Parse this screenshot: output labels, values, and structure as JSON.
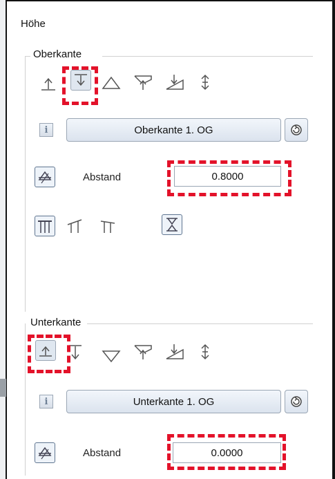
{
  "panel": {
    "title": "Höhe"
  },
  "accent_color": "#e3122a",
  "oberkante": {
    "group_label": "Oberkante",
    "level_button_label": "Oberkante 1. OG",
    "distance_label": "Abstand",
    "distance_value": "0.8000",
    "reference_tools": [
      "top-edge-up-icon",
      "top-edge-down-icon",
      "triangle-up-icon",
      "plane-flag-icon",
      "slope-arrow-icon",
      "up-down-arrow-icon"
    ],
    "selected_tool": "top-edge-down-icon",
    "roof_tools": [
      "roof-flat-icon",
      "roof-slope-left-icon",
      "roof-slope-right-icon"
    ],
    "extra_tool": "hourglass-icon"
  },
  "unterkante": {
    "group_label": "Unterkante",
    "level_button_label": "Unterkante 1. OG",
    "distance_label": "Abstand",
    "distance_value": "0.0000",
    "reference_tools": [
      "bottom-edge-up-icon",
      "bottom-edge-down-icon",
      "triangle-down-icon",
      "plane-flag-icon",
      "slope-arrow-icon",
      "up-down-arrow-icon"
    ],
    "selected_tool": "bottom-edge-up-icon"
  }
}
